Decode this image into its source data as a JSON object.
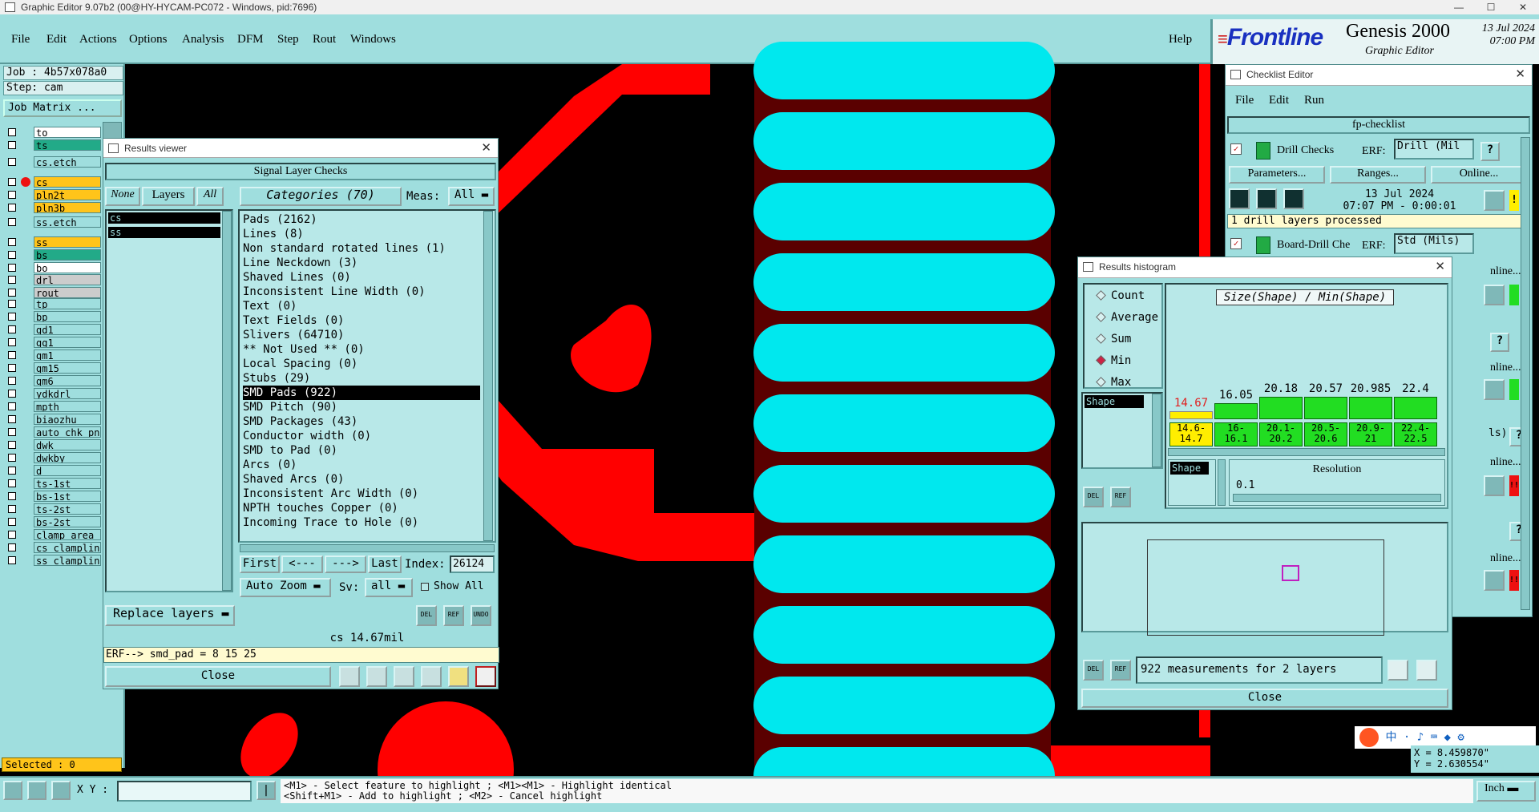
{
  "window": {
    "title": "Graphic Editor 9.07b2 (00@HY-HYCAM-PC072 - Windows, pid:7696)",
    "minimize": "—",
    "maximize": "☐",
    "close": "✕"
  },
  "menu": {
    "items": [
      "File",
      "Edit",
      "Actions",
      "Options",
      "Analysis",
      "DFM",
      "Step",
      "Rout",
      "Windows"
    ],
    "help": "Help"
  },
  "brand": {
    "logo": "Frontline",
    "product": "Genesis 2000",
    "subtitle": "Graphic Editor",
    "date": "13 Jul 2024",
    "time": "07:00 PM"
  },
  "job": {
    "job": "Job : 4b57x078a0",
    "step": "Step: cam",
    "job_matrix": "Job Matrix ..."
  },
  "layers": [
    {
      "name": "to",
      "color": "#ffffff"
    },
    {
      "name": "ts",
      "color": "#22aa88"
    },
    {
      "name": "cs.etch",
      "color": "#9fdede"
    },
    {
      "name": "cs",
      "color": "#ffc41a"
    },
    {
      "name": "pln2t",
      "color": "#ffc41a"
    },
    {
      "name": "pln3b",
      "color": "#ffc41a"
    },
    {
      "name": "ss.etch",
      "color": "#9fdede"
    },
    {
      "name": "ss",
      "color": "#ffc41a"
    },
    {
      "name": "bs",
      "color": "#22aa88"
    },
    {
      "name": "bo",
      "color": "#ffffff"
    },
    {
      "name": "drl",
      "color": "#cccccc"
    },
    {
      "name": "rout",
      "color": "#cccccc"
    },
    {
      "name": "tp",
      "color": "#9fdede"
    },
    {
      "name": "bp",
      "color": "#9fdede"
    },
    {
      "name": "gd1",
      "color": "#9fdede"
    },
    {
      "name": "gg1",
      "color": "#9fdede"
    },
    {
      "name": "gm1",
      "color": "#9fdede"
    },
    {
      "name": "gm15",
      "color": "#9fdede"
    },
    {
      "name": "gm6",
      "color": "#9fdede"
    },
    {
      "name": "ydkdrl",
      "color": "#9fdede"
    },
    {
      "name": "mpth",
      "color": "#9fdede"
    },
    {
      "name": "biaozhu",
      "color": "#9fdede"
    },
    {
      "name": "auto_chk_pn",
      "color": "#9fdede"
    },
    {
      "name": "dwk",
      "color": "#9fdede"
    },
    {
      "name": "dwkby",
      "color": "#9fdede"
    },
    {
      "name": "d",
      "color": "#9fdede"
    },
    {
      "name": "ts-1st",
      "color": "#9fdede"
    },
    {
      "name": "bs-1st",
      "color": "#9fdede"
    },
    {
      "name": "ts-2st",
      "color": "#9fdede"
    },
    {
      "name": "bs-2st",
      "color": "#9fdede"
    },
    {
      "name": "clamp_area",
      "color": "#9fdede"
    },
    {
      "name": "cs_clampline",
      "color": "#9fdede"
    },
    {
      "name": "ss_clampline",
      "color": "#9fdede"
    }
  ],
  "selected": "Selected : 0",
  "results_viewer": {
    "title": "Results viewer",
    "header": "Signal Layer Checks",
    "none": "None",
    "layers_btn": "Layers",
    "all": "All",
    "categories_btn": "Categories (70)",
    "meas_label": "Meas:",
    "meas_value": "All",
    "layer_list": [
      "cs",
      "ss"
    ],
    "categories": [
      "Pads (2162)",
      "Lines (8)",
      "Non standard rotated lines (1)",
      "Line Neckdown (3)",
      "Shaved Lines (0)",
      "Inconsistent Line Width (0)",
      "Text (0)",
      "Text Fields (0)",
      "Slivers (64710)",
      "** Not Used ** (0)",
      "Local Spacing (0)",
      "Stubs (29)",
      "SMD Pads (922)",
      "SMD Pitch (90)",
      "SMD Packages (43)",
      "Conductor width (0)",
      "SMD to Pad (0)",
      "Arcs (0)",
      "Shaved Arcs (0)",
      "Inconsistent Arc Width (0)",
      "NPTH touches Copper (0)",
      "Incoming Trace to Hole (0)"
    ],
    "selected_index": 12,
    "first": "First",
    "prev": "<---",
    "next": "--->",
    "last": "Last",
    "index_label": "Index:",
    "index_value": "26124",
    "auto_zoom": "Auto Zoom",
    "sv_label": "Sv:",
    "sv_value": "all",
    "show_all": "Show All",
    "replace_layers": "Replace layers",
    "status": "cs 14.67mil",
    "erf": "ERF--> smd_pad = 8 15 25",
    "close": "Close"
  },
  "checklist": {
    "title": "Checklist Editor",
    "menu": [
      "File",
      "Edit",
      "Run"
    ],
    "name": "fp-checklist",
    "drill_checks": "Drill Checks",
    "erf_label": "ERF:",
    "erf_value": "Drill (Mil",
    "parameters": "Parameters...",
    "ranges": "Ranges...",
    "online": "Online...",
    "run_date": "13 Jul 2024",
    "run_time": "07:07 PM - 0:00:01",
    "summary": "1 drill layers processed",
    "board_drill": "Board-Drill Che",
    "erf_value2": "Std (Mils)",
    "online_short": "nline...",
    "ls": "ls)",
    "help": "?",
    "warn": "!",
    "alert": "!!"
  },
  "histogram": {
    "title": "Results histogram",
    "modes": [
      "Count",
      "Average",
      "Sum",
      "Min",
      "Max"
    ],
    "selected_mode": "Min",
    "shape_label": "Shape",
    "chart_title": "Size(Shape) / Min(Shape)",
    "bins": [
      {
        "value": "14.67",
        "range_top": "14.6-",
        "range_bot": "14.7",
        "level": 0.35
      },
      {
        "value": "16.05",
        "range_top": "16-",
        "range_bot": "16.1",
        "level": 0.7
      },
      {
        "value": "20.18",
        "range_top": "20.1-",
        "range_bot": "20.2",
        "level": 1.0
      },
      {
        "value": "20.57",
        "range_top": "20.5-",
        "range_bot": "20.6",
        "level": 1.0
      },
      {
        "value": "20.985",
        "range_top": "20.9-",
        "range_bot": "21",
        "level": 1.0
      },
      {
        "value": "22.4",
        "range_top": "22.4-",
        "range_bot": "22.5",
        "level": 1.0
      }
    ],
    "resolution_label": "Resolution",
    "resolution_value": "0.1",
    "measurements": "922 measurements for 2 layers",
    "close": "Close"
  },
  "coords": {
    "x": "X = 8.459870\"",
    "y": "Y = 2.630554\""
  },
  "status": {
    "xy_label": "X Y :",
    "hint1": "<M1> - Select feature to highlight ; <M1><M1> - Highlight identical",
    "hint2": "<Shift+M1> - Add to highlight ; <M2> - Cancel highlight",
    "units": "Inch"
  },
  "ime": {
    "lang": "中"
  },
  "icons": {
    "del": "DEL",
    "ref": "REF",
    "undo": "UNDO"
  }
}
